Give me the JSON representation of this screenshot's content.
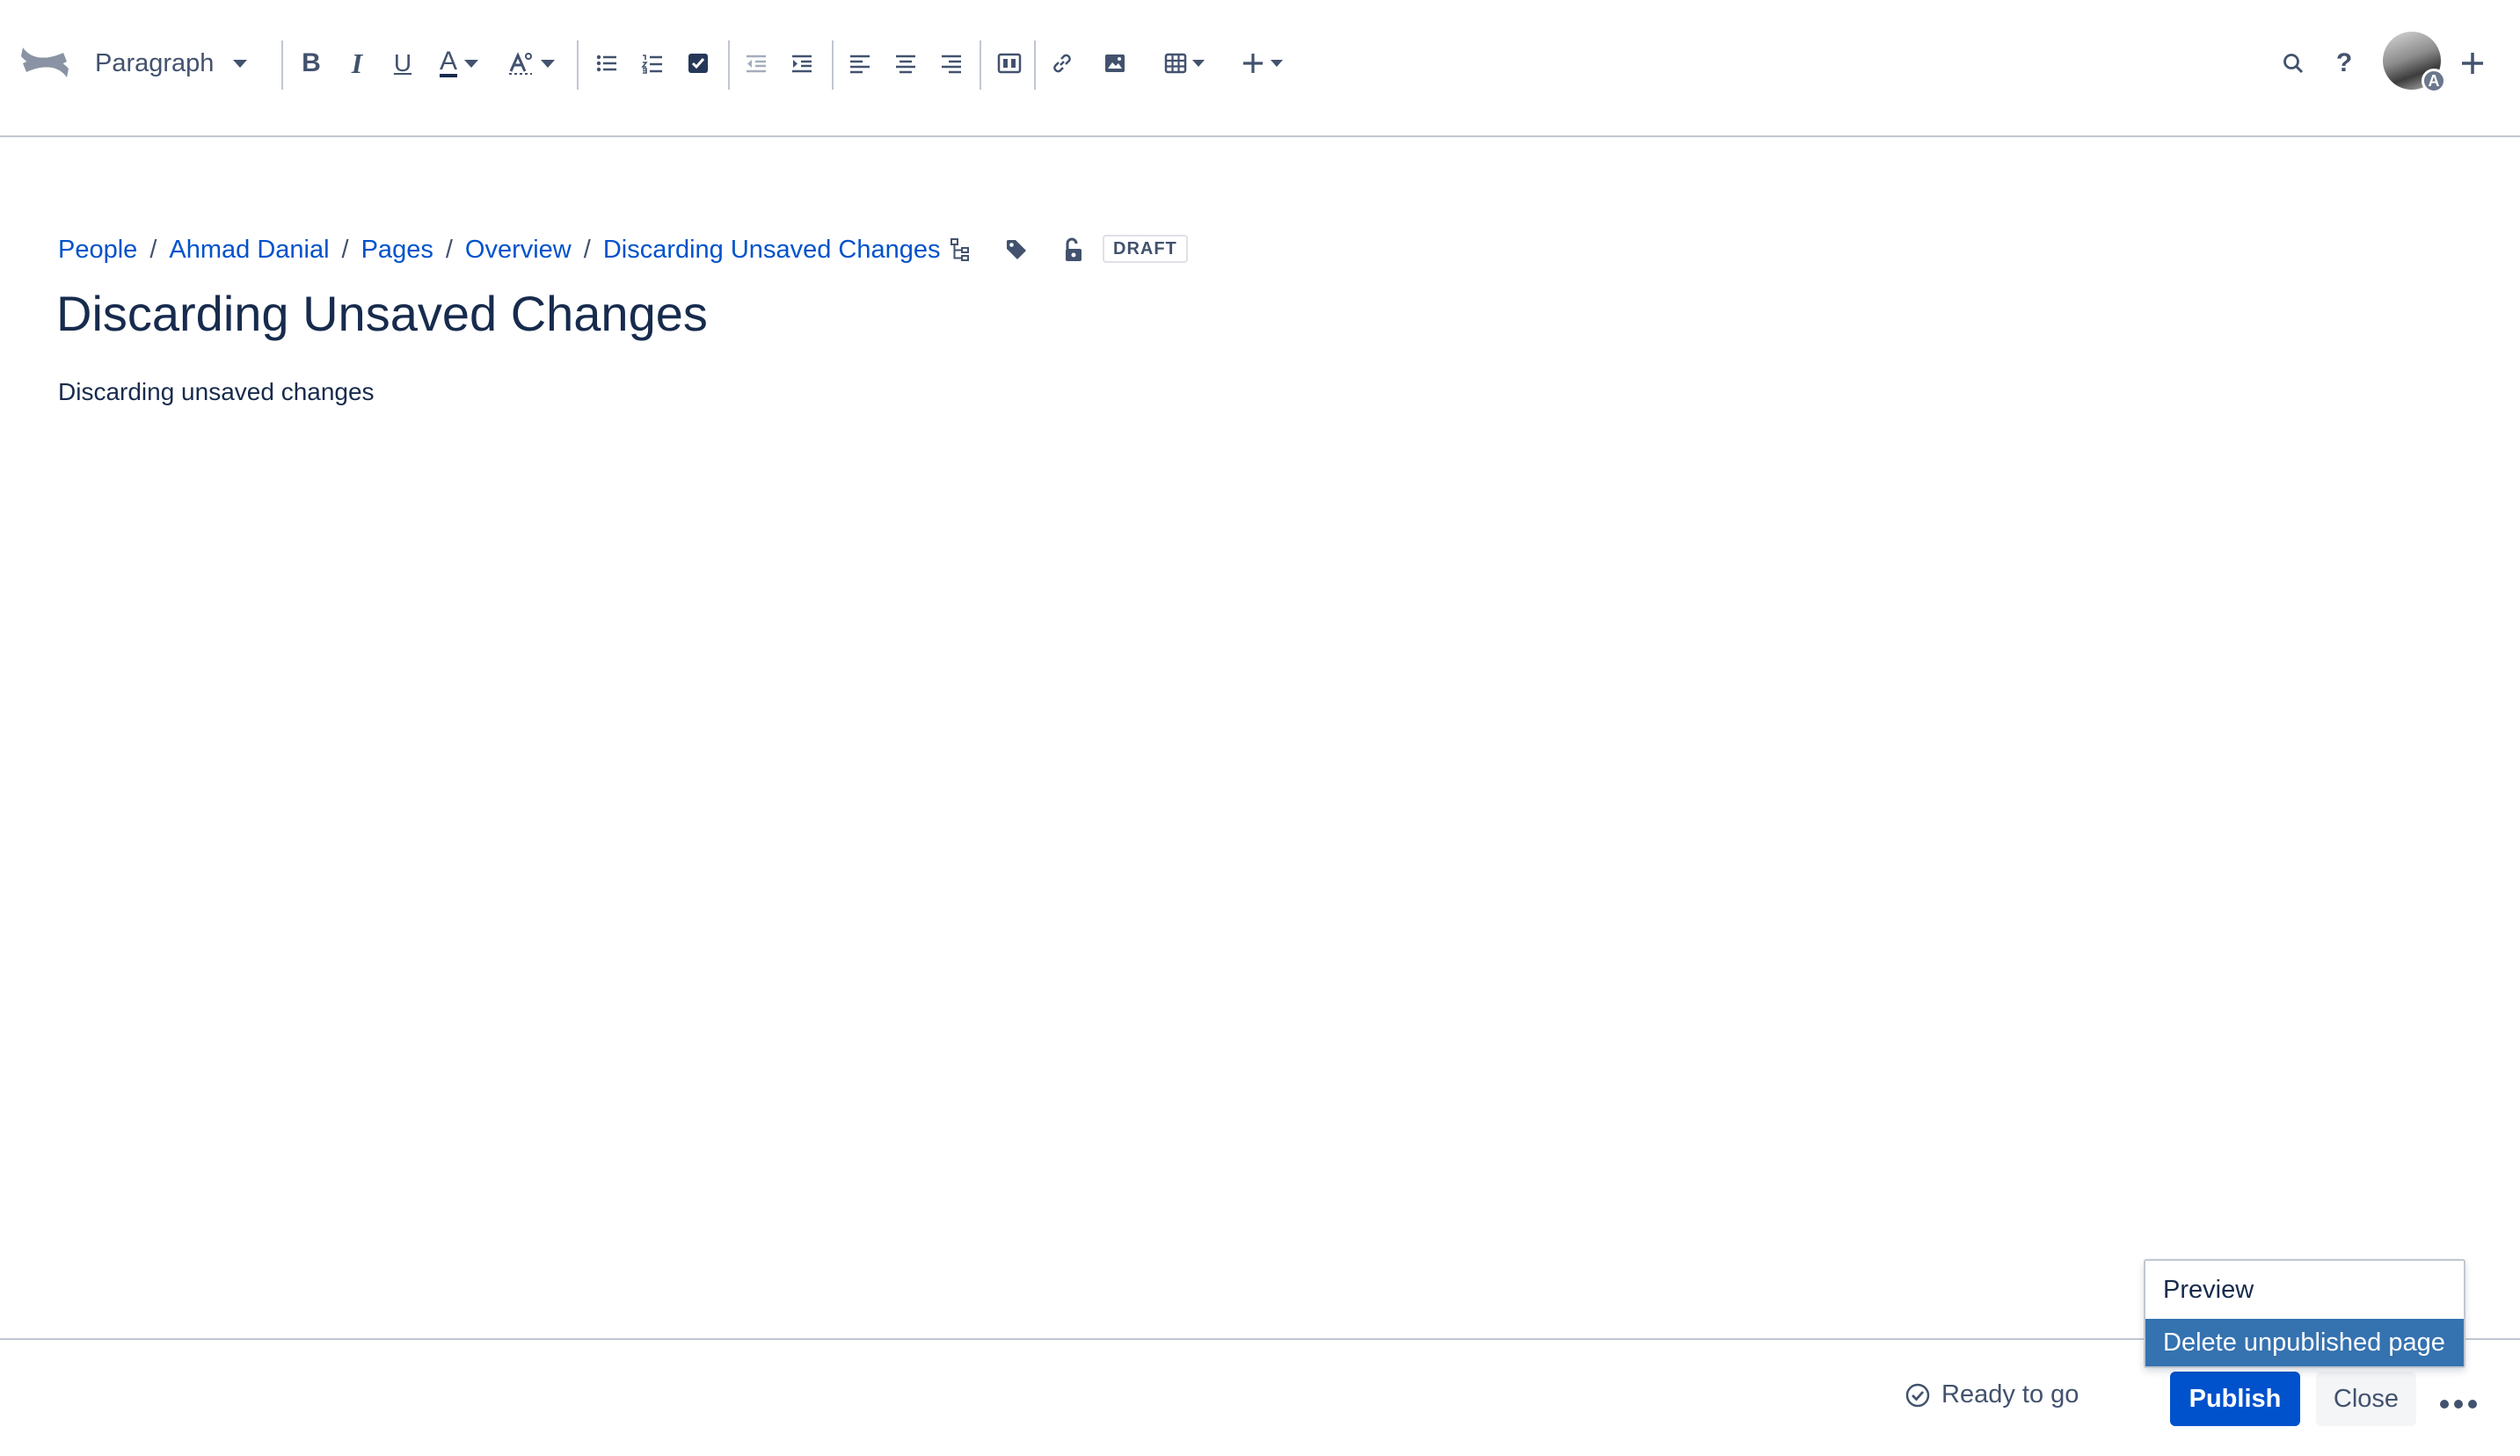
{
  "toolbar": {
    "text_style": "Paragraph",
    "buttons": [
      "bold-icon",
      "italic-icon",
      "underline-icon",
      "text-color-icon",
      "text-formatting-icon",
      "bullet-list-icon",
      "numbered-list-icon",
      "task-list-icon",
      "outdent-icon",
      "indent-icon",
      "align-left-icon",
      "align-center-icon",
      "align-right-icon",
      "page-layout-icon",
      "link-icon",
      "image-icon",
      "table-icon",
      "insert-more-icon"
    ],
    "avatar_badge": "A"
  },
  "breadcrumb": [
    "People",
    "Ahmad Danial",
    "Pages",
    "Overview",
    "Discarding Unsaved Changes"
  ],
  "breadcrumb_separator": "/",
  "status_lozenge": "DRAFT",
  "page": {
    "title": "Discarding Unsaved Changes",
    "body": "Discarding unsaved changes"
  },
  "footer": {
    "status": "Ready to go",
    "publish_label": "Publish",
    "close_label": "Close"
  },
  "menu": {
    "items": [
      "Preview",
      "Delete unpublished page"
    ],
    "highlighted": "Delete unpublished page"
  },
  "colors": {
    "link": "#0052cc",
    "primary_button": "#0052cc",
    "menu_highlight": "#3572b0",
    "text": "#172b4d"
  }
}
